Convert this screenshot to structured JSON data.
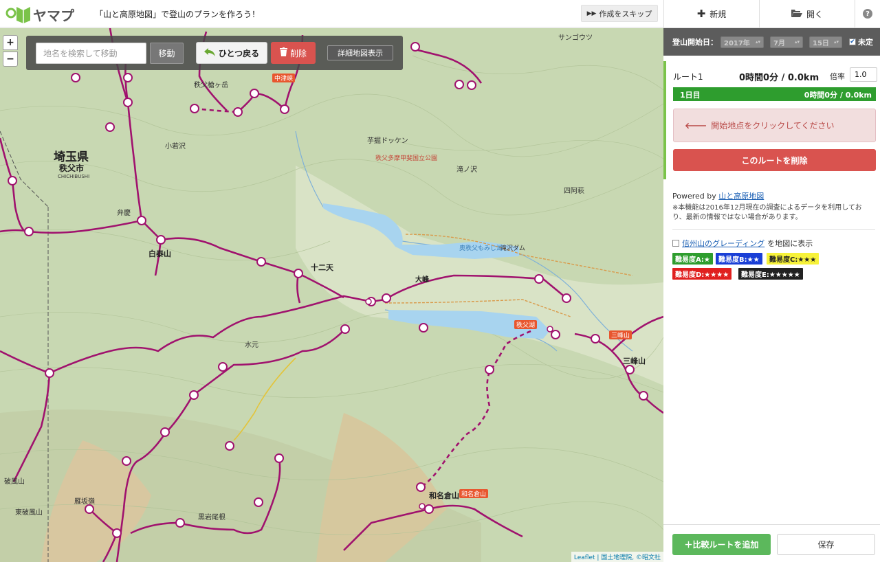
{
  "header": {
    "logo_text": "ヤマプラ",
    "tagline": "「山と高原地図」で登山のプランを作ろう！",
    "skip_label": "作成をスキップ"
  },
  "tabs": {
    "new_label": "新規",
    "open_label": "開く"
  },
  "map_toolbar": {
    "search_placeholder": "地名を検索して移動",
    "move_label": "移動",
    "undo_label": "ひとつ戻る",
    "delete_label": "削除",
    "detail_label": "詳細地図表示"
  },
  "zoom": {
    "in": "+",
    "out": "−"
  },
  "map_labels": {
    "prefecture": "埼玉県",
    "city": "秩父市",
    "city_romaji": "CHICHIBUSHI",
    "lake": "奥秩父もみじ湖",
    "dam": "滝沢ダム",
    "park": "秩父多摩甲斐国立公園",
    "shiraiwa": "白泰山",
    "jizo": "十二天",
    "omine": "大峰",
    "mitsumine": "三峰山",
    "mitsumine_tag": "三峰山",
    "wanakura": "和名倉山",
    "wanakura_tag": "和名倉山",
    "chichibu_lake": "秩父湖",
    "nakatsukyo": "中津峡",
    "suimoto": "水元",
    "takidosawa": "滝ノ沢",
    "koakasawa": "小若沢",
    "benkei": "弁慶",
    "kanbagatake": "秩父槍ヶ岳",
    "rasaka": "雁坂嶺",
    "hagahira": "破風山",
    "higashi_hagahira": "東破風山",
    "kuroiwa": "黒岩尾根",
    "sangoutsu": "サンゴウツ",
    "imokawa": "芋掘ドッケン",
    "shirokannon": "四阿萩"
  },
  "attribution": "Leaflet | 国土地理院, ©昭文社",
  "panel": {
    "start_date_label": "登山開始日：",
    "year": "2017年",
    "month": "7月",
    "day": "15日",
    "undecided_label": "未定",
    "route_name": "ルート1",
    "route_total": "0時間0分 / 0.0km",
    "rate_label": "倍率",
    "rate_value": "1.0",
    "day_label": "1日目",
    "day_total": "0時間0分 / 0.0km",
    "start_alert": "開始地点をクリックしてください",
    "delete_route_label": "このルートを削除",
    "powered_prefix": "Powered by",
    "powered_link": "山と高原地図",
    "notice": "※本機能は2016年12月現在の調査によるデータを利用しており、最新の情報ではない場合があります。",
    "grading_link": "信州山のグレーディング",
    "grading_suffix": "を地図に表示",
    "difficulty": [
      {
        "label": "難易度A:★",
        "bg": "#2e9d2e",
        "fg": "#ffffff"
      },
      {
        "label": "難易度B:★★",
        "bg": "#1a3fd6",
        "fg": "#ffffff"
      },
      {
        "label": "難易度C:★★★",
        "bg": "#f7f23a",
        "fg": "#222222"
      },
      {
        "label": "難易度D:★★★★",
        "bg": "#e0201f",
        "fg": "#ffffff"
      },
      {
        "label": "難易度E:★★★★★",
        "bg": "#222222",
        "fg": "#ffffff"
      }
    ],
    "compare_label": "＋比較ルートを追加",
    "save_label": "保存"
  },
  "colors": {
    "route_magenta": "#a0126e",
    "accent_green": "#7bc34a",
    "danger": "#d9534f",
    "success": "#5cb85c"
  }
}
